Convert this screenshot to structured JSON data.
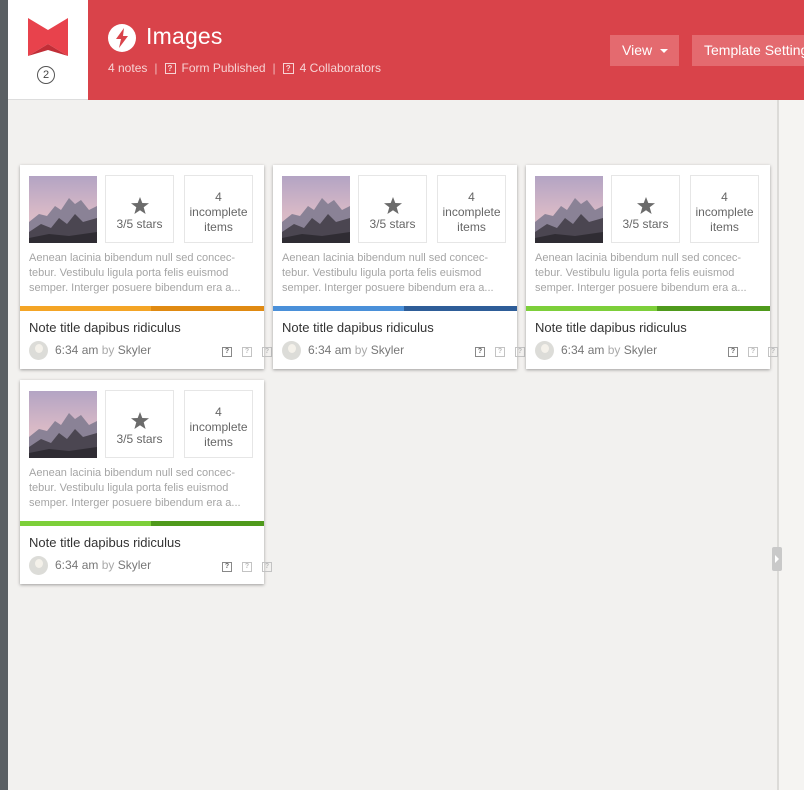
{
  "header": {
    "badge_count": "2",
    "title": "Images",
    "notes_count": "4 notes",
    "form_status": "Form Published",
    "collaborators": "4 Collaborators",
    "view_label": "View",
    "template_settings_label": "Template Settings",
    "accent_color": "#d9434a"
  },
  "cards": [
    {
      "stars": "3/5 stars",
      "incomplete_count": "4",
      "incomplete_label": "incomplete",
      "incomplete_suffix": "items",
      "description_1": "Aenean lacinia bibendum null sed concec-",
      "description_2": "tebur. Vestibulu ligula porta felis euismod",
      "description_3": "semper. Interger posuere bibendum era a...",
      "bar_colors": [
        "#f4a526",
        "#e08a12"
      ],
      "title": "Note title dapibus ridiculus",
      "time": "6:34 am",
      "by": "by",
      "author": "Skyler"
    },
    {
      "stars": "3/5 stars",
      "incomplete_count": "4",
      "incomplete_label": "incomplete",
      "incomplete_suffix": "items",
      "description_1": "Aenean lacinia bibendum null sed concec-",
      "description_2": "tebur. Vestibulu ligula porta felis euismod",
      "description_3": "semper. Interger posuere bibendum era a...",
      "bar_colors": [
        "#4a90d9",
        "#2e5d98"
      ],
      "title": "Note title dapibus ridiculus",
      "time": "6:34 am",
      "by": "by",
      "author": "Skyler"
    },
    {
      "stars": "3/5 stars",
      "incomplete_count": "4",
      "incomplete_label": "incomplete",
      "incomplete_suffix": "items",
      "description_1": "Aenean lacinia bibendum null sed concec-",
      "description_2": "tebur. Vestibulu ligula porta felis euismod",
      "description_3": "semper. Interger posuere bibendum era a...",
      "bar_colors": [
        "#7dcf3a",
        "#4f9a1c"
      ],
      "title": "Note title dapibus ridiculus",
      "time": "6:34 am",
      "by": "by",
      "author": "Skyler"
    },
    {
      "stars": "3/5 stars",
      "incomplete_count": "4",
      "incomplete_label": "incomplete",
      "incomplete_suffix": "items",
      "description_1": "Aenean lacinia bibendum null sed concec-",
      "description_2": "tebur. Vestibulu ligula porta felis euismod",
      "description_3": "semper. Interger posuere bibendum era a...",
      "bar_colors": [
        "#7dcf3a",
        "#4f9a1c"
      ],
      "title": "Note title dapibus ridiculus",
      "time": "6:34 am",
      "by": "by",
      "author": "Skyler"
    }
  ]
}
